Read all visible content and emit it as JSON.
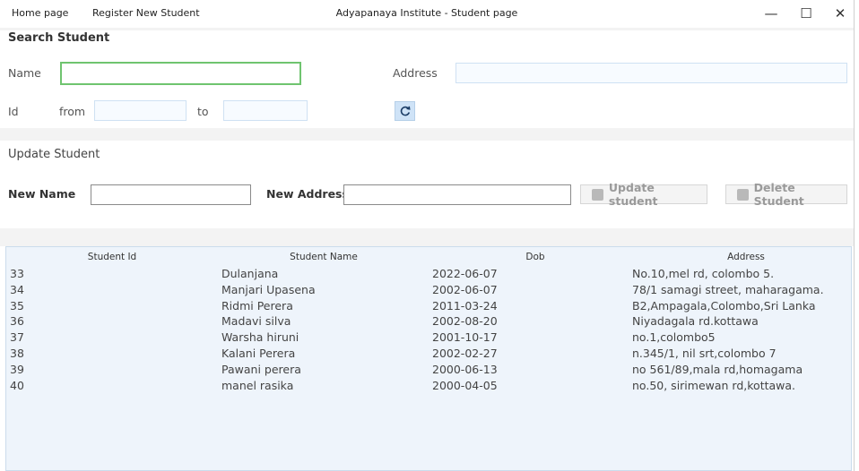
{
  "window": {
    "title": "Adyapanaya Institute - Student page",
    "menu": [
      "Home page",
      "Register New Student"
    ],
    "controls": {
      "minimize": "—",
      "maximize": "☐",
      "close": "✕"
    }
  },
  "search": {
    "title": "Search Student",
    "name_label": "Name",
    "name_value": "",
    "address_label": "Address",
    "address_value": "",
    "id_label": "Id",
    "from_label": "from",
    "from_value": "",
    "to_label": "to",
    "to_value": ""
  },
  "update": {
    "title": "Update Student",
    "new_name_label": "New Name",
    "new_name_value": "",
    "new_address_label": "New Address",
    "new_address_value": "",
    "update_button": "Update student",
    "delete_button": "Delete Student"
  },
  "table": {
    "columns": [
      "Student Id",
      "Student Name",
      "Dob",
      "Address"
    ],
    "rows": [
      [
        "33",
        "Dulanjana",
        "2022-06-07",
        "No.10,mel rd, colombo 5."
      ],
      [
        "34",
        "Manjari Upasena",
        "2002-06-07",
        "78/1 samagi street, maharagama."
      ],
      [
        "35",
        "Ridmi Perera",
        "2011-03-24",
        "B2,Ampagala,Colombo,Sri Lanka"
      ],
      [
        "36",
        "Madavi silva",
        "2002-08-20",
        "Niyadagala rd.kottawa"
      ],
      [
        "37",
        "Warsha hiruni",
        "2001-10-17",
        "no.1,colombo5"
      ],
      [
        "38",
        "Kalani Perera",
        "2002-02-27",
        "n.345/1, nil srt,colombo 7"
      ],
      [
        "39",
        "Pawani perera",
        "2000-06-13",
        "no 561/89,mala rd,homagama"
      ],
      [
        "40",
        "manel rasika",
        "2000-04-05",
        "no.50, sirimewan rd,kottawa."
      ]
    ]
  },
  "colors": {
    "active_border": "#6fc46f",
    "field_border": "#cfe1f3",
    "table_bg": "#eef4fb",
    "band_bg": "#f3f3f3"
  }
}
